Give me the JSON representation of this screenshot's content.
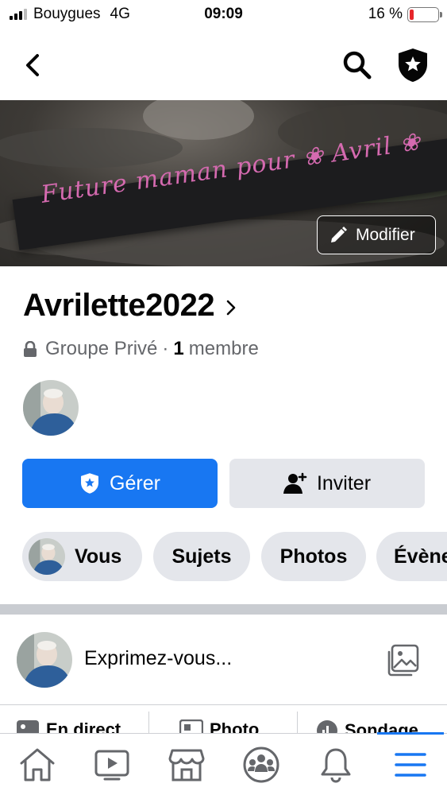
{
  "status_bar": {
    "carrier": "Bouygues",
    "network": "4G",
    "time": "09:09",
    "battery_percent": "16 %",
    "battery_level": 0.16,
    "battery_color": "#e6262b"
  },
  "header": {
    "back_icon": "chevron-left-icon",
    "search_icon": "search-icon",
    "admin_icon": "admin-shield-star-icon"
  },
  "cover": {
    "ribbon_text": "Future maman pour ❀ Avril ❀",
    "edit_label": "Modifier"
  },
  "group": {
    "name": "Avrilette2022",
    "privacy": "Groupe Privé",
    "separator": "·",
    "member_count": "1",
    "member_label": "membre"
  },
  "actions": {
    "manage_label": "Gérer",
    "invite_label": "Inviter"
  },
  "chips": {
    "you": "Vous",
    "topics": "Sujets",
    "photos": "Photos",
    "events": "Évènements"
  },
  "composer": {
    "placeholder": "Exprimez-vous...",
    "quick_actions": {
      "live": "En direct",
      "photo": "Photo",
      "poll": "Sondage"
    }
  },
  "tab_bar": {
    "tabs": [
      "home-icon",
      "video-icon",
      "marketplace-icon",
      "groups-icon",
      "notifications-icon",
      "menu-icon"
    ],
    "active_index": 5
  },
  "colors": {
    "primary": "#1877f2",
    "secondary_button": "#e4e6eb",
    "muted_text": "#65676b",
    "ribbon_text": "#d56ab0"
  }
}
